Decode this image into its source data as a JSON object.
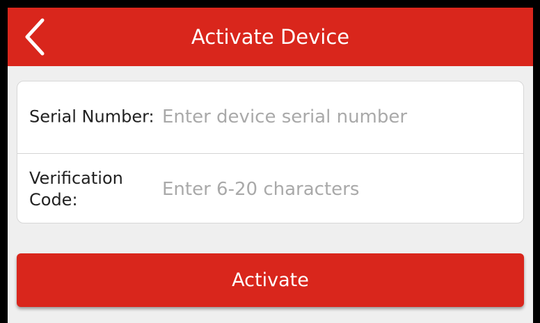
{
  "header": {
    "title": "Activate Device",
    "back_icon": "chevron-left-icon",
    "background_color": "#d9261c"
  },
  "form": {
    "serial": {
      "label": "Serial Number:",
      "placeholder": "Enter device serial number",
      "value": ""
    },
    "verification": {
      "label": "Verification Code:",
      "placeholder": "Enter 6-20 characters",
      "value": ""
    }
  },
  "actions": {
    "activate_label": "Activate",
    "button_color": "#d9261c"
  }
}
